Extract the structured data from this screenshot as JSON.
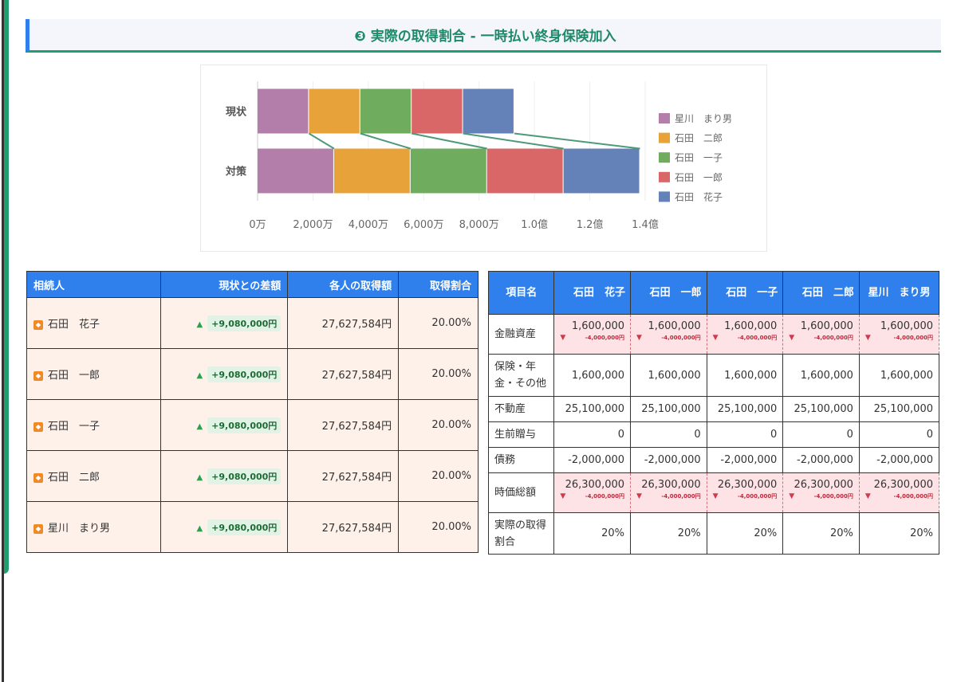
{
  "section": {
    "title": "❸ 実際の取得割合 - 一時払い終身保険加入"
  },
  "chart_data": {
    "type": "bar",
    "orientation": "horizontal",
    "stacked": true,
    "categories": [
      "現状",
      "対策"
    ],
    "series": [
      {
        "name": "星川　まり男",
        "color": "#b47eaa",
        "values": [
          18547584,
          27627584
        ]
      },
      {
        "name": "石田　二郎",
        "color": "#e8a23a",
        "values": [
          18547584,
          27627584
        ]
      },
      {
        "name": "石田　一子",
        "color": "#6fac5e",
        "values": [
          18547584,
          27627584
        ]
      },
      {
        "name": "石田　一郎",
        "color": "#d96767",
        "values": [
          18547584,
          27627584
        ]
      },
      {
        "name": "石田　花子",
        "color": "#6582b8",
        "values": [
          18547584,
          27627584
        ]
      }
    ],
    "xlim": [
      0,
      140000000
    ],
    "xticks": [
      {
        "value": 0,
        "label": "0万"
      },
      {
        "value": 20000000,
        "label": "2,000万"
      },
      {
        "value": 40000000,
        "label": "4,000万"
      },
      {
        "value": 60000000,
        "label": "6,000万"
      },
      {
        "value": 80000000,
        "label": "8,000万"
      },
      {
        "value": 100000000,
        "label": "1.0億"
      },
      {
        "value": 120000000,
        "label": "1.2億"
      },
      {
        "value": 140000000,
        "label": "1.4億"
      }
    ],
    "grid": true,
    "legend_position": "right",
    "connector_color": "#4e9a78"
  },
  "left_table": {
    "headers": [
      "相続人",
      "現状との差額",
      "各人の取得額",
      "取得割合"
    ],
    "rows": [
      {
        "name": "石田　花子",
        "diff": "+9,080,000円",
        "amount": "27,627,584円",
        "ratio": "20.00%"
      },
      {
        "name": "石田　一郎",
        "diff": "+9,080,000円",
        "amount": "27,627,584円",
        "ratio": "20.00%"
      },
      {
        "name": "石田　一子",
        "diff": "+9,080,000円",
        "amount": "27,627,584円",
        "ratio": "20.00%"
      },
      {
        "name": "石田　二郎",
        "diff": "+9,080,000円",
        "amount": "27,627,584円",
        "ratio": "20.00%"
      },
      {
        "name": "星川　まり男",
        "diff": "+9,080,000円",
        "amount": "27,627,584円",
        "ratio": "20.00%"
      }
    ]
  },
  "right_table": {
    "headers": [
      "項目名",
      "石田　花子",
      "石田　一郎",
      "石田　一子",
      "石田　二郎",
      "星川　まり男"
    ],
    "rows": [
      {
        "item": "金融資産",
        "highlight": true,
        "values": [
          "1,600,000",
          "1,600,000",
          "1,600,000",
          "1,600,000",
          "1,600,000"
        ],
        "subs": [
          "-4,000,000円",
          "-4,000,000円",
          "-4,000,000円",
          "-4,000,000円",
          "-4,000,000円"
        ]
      },
      {
        "item": "保険・年金・その他",
        "values": [
          "1,600,000",
          "1,600,000",
          "1,600,000",
          "1,600,000",
          "1,600,000"
        ]
      },
      {
        "item": "不動産",
        "values": [
          "25,100,000",
          "25,100,000",
          "25,100,000",
          "25,100,000",
          "25,100,000"
        ]
      },
      {
        "item": "生前贈与",
        "values": [
          "0",
          "0",
          "0",
          "0",
          "0"
        ]
      },
      {
        "item": "債務",
        "values": [
          "-2,000,000",
          "-2,000,000",
          "-2,000,000",
          "-2,000,000",
          "-2,000,000"
        ]
      },
      {
        "item": "時価総額",
        "highlight": true,
        "values": [
          "26,300,000",
          "26,300,000",
          "26,300,000",
          "26,300,000",
          "26,300,000"
        ],
        "subs": [
          "-4,000,000円",
          "-4,000,000円",
          "-4,000,000円",
          "-4,000,000円",
          "-4,000,000円"
        ]
      },
      {
        "item": "実際の取得割合",
        "values": [
          "20%",
          "20%",
          "20%",
          "20%",
          "20%"
        ]
      }
    ]
  }
}
